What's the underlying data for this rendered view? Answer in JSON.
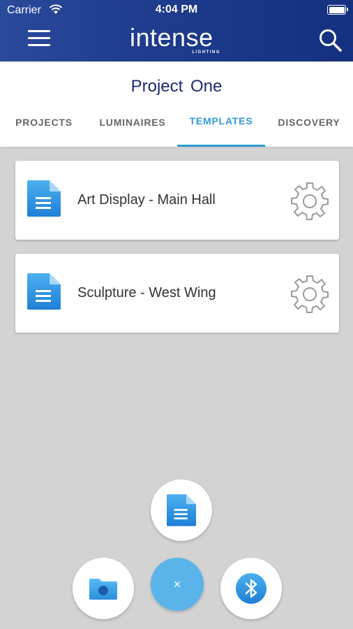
{
  "status_bar": {
    "carrier": "Carrier",
    "time": "4:04 PM"
  },
  "header": {
    "logo_text": "intense",
    "logo_subtext": "LIGHTING",
    "menu_icon": "hamburger-menu-icon",
    "search_icon": "search-icon"
  },
  "project": {
    "title": "Project  One"
  },
  "tabs": [
    {
      "label": "PROJECTS",
      "active": false
    },
    {
      "label": "LUMINAIRES",
      "active": false
    },
    {
      "label": "TEMPLATES",
      "active": true
    },
    {
      "label": "DISCOVERY",
      "active": false
    }
  ],
  "templates": [
    {
      "name": "Art Display - Main Hall",
      "icon": "document-icon",
      "action_icon": "gear-icon"
    },
    {
      "name": "Sculpture - West Wing",
      "icon": "document-icon",
      "action_icon": "gear-icon"
    }
  ],
  "fab": {
    "close_label": "×",
    "document_icon": "document-icon",
    "folder_icon": "folder-icon",
    "bluetooth_icon": "bluetooth-icon"
  },
  "colors": {
    "header_bg": "#1f3c8e",
    "accent": "#2e9bd6",
    "title": "#1e2a6e",
    "fab_close": "#5ab4ea",
    "background": "#d3d3d3"
  }
}
